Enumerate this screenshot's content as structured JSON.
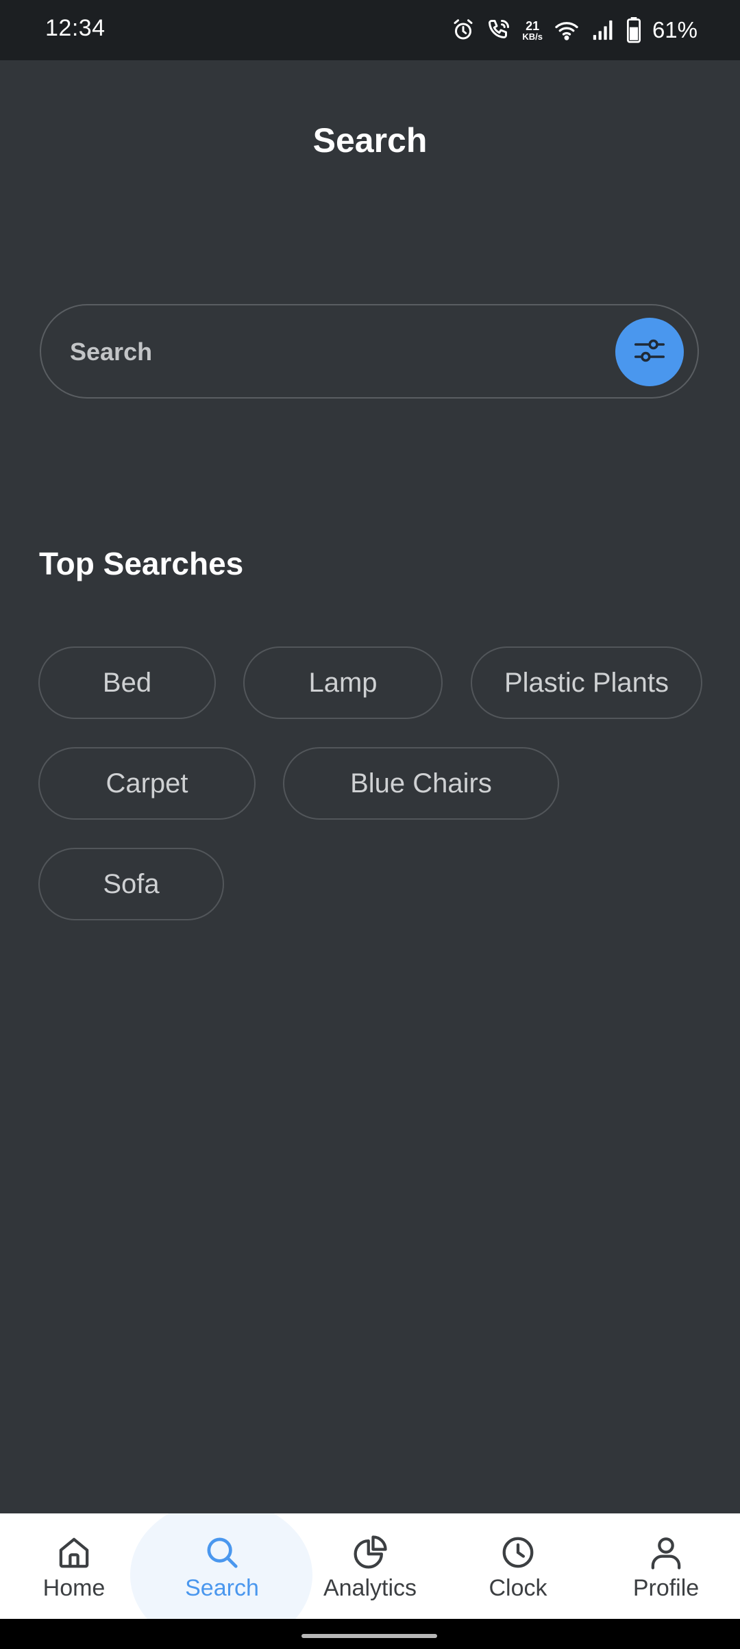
{
  "status_bar": {
    "time": "12:34",
    "net_speed_value": "21",
    "net_speed_unit": "KB/s",
    "battery_percent": "61%",
    "icons": [
      "alarm-icon",
      "wifi-call-icon",
      "wifi-icon",
      "signal-icon",
      "battery-icon"
    ]
  },
  "header": {
    "title": "Search"
  },
  "search": {
    "placeholder": "Search",
    "filter_icon": "sliders-icon",
    "accent_color": "#4a97ee"
  },
  "top_searches": {
    "title": "Top Searches",
    "chips": [
      "Bed",
      "Lamp",
      "Plastic Plants",
      "Carpet",
      "Blue Chairs",
      "Sofa"
    ]
  },
  "bottom_nav": {
    "active": "Search",
    "items": [
      {
        "label": "Home",
        "icon": "home-icon"
      },
      {
        "label": "Search",
        "icon": "search-icon"
      },
      {
        "label": "Analytics",
        "icon": "pie-chart-icon"
      },
      {
        "label": "Clock",
        "icon": "clock-icon"
      },
      {
        "label": "Profile",
        "icon": "user-icon"
      }
    ]
  },
  "colors": {
    "background": "#32363a",
    "status_bar": "#1c1f22",
    "accent": "#4a97ee",
    "nav_background": "#ffffff"
  }
}
